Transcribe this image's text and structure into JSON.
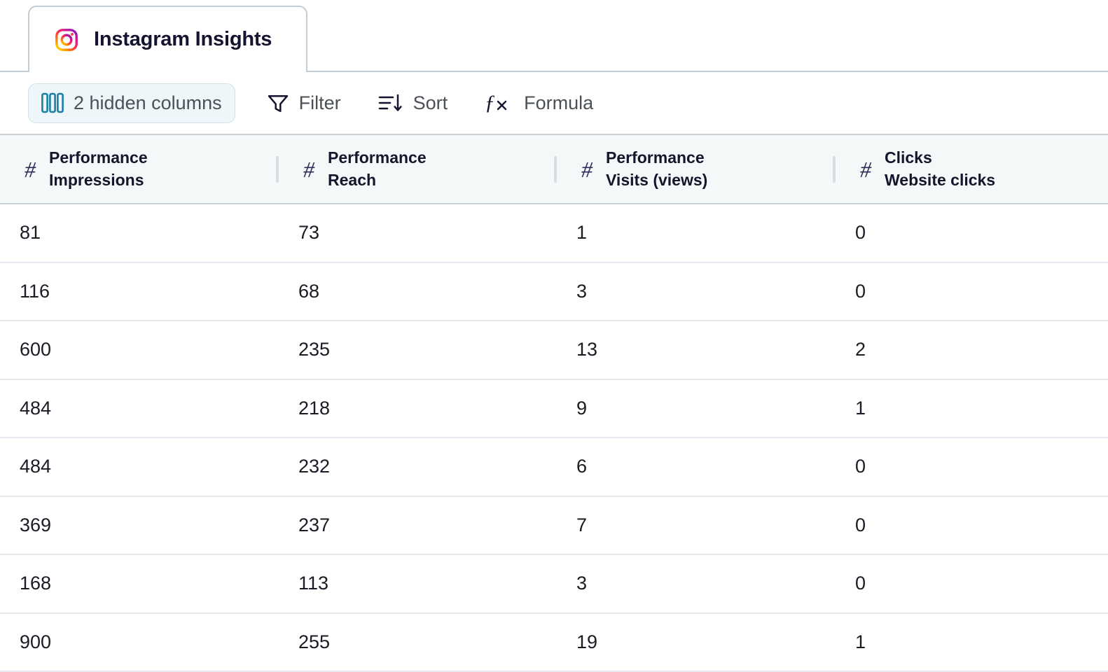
{
  "window": {
    "background": "#ffffff"
  },
  "tabs": {
    "active_index": 0,
    "items": [
      {
        "label": "Instagram Insights",
        "icon": "instagram-icon"
      }
    ]
  },
  "toolbar": {
    "hidden_columns": {
      "label": "2 hidden columns",
      "icon": "columns-icon",
      "icon_color": "#1a7fa4",
      "background": "#eef6f9",
      "border_color": "#d3e2e8",
      "text_color": "#4b5156"
    },
    "buttons": [
      {
        "label": "Filter",
        "icon": "funnel-icon"
      },
      {
        "label": "Sort",
        "icon": "sort-descending-icon"
      },
      {
        "label": "Formula",
        "icon": "function-fx-icon"
      }
    ]
  },
  "table": {
    "header_background": "#f4f8f9",
    "border_color": "#c9d2d8",
    "row_border_color": "#e4e8ef",
    "columns": [
      {
        "type_icon": "number-hash-icon",
        "group": "Performance",
        "name": "Impressions"
      },
      {
        "type_icon": "number-hash-icon",
        "group": "Performance",
        "name": "Reach"
      },
      {
        "type_icon": "number-hash-icon",
        "group": "Performance",
        "name": "Visits (views)"
      },
      {
        "type_icon": "number-hash-icon",
        "group": "Clicks",
        "name": "Website clicks"
      }
    ],
    "rows": [
      {
        "impressions": "81",
        "reach": "73",
        "visits": "1",
        "website_clicks": "0"
      },
      {
        "impressions": "116",
        "reach": "68",
        "visits": "3",
        "website_clicks": "0"
      },
      {
        "impressions": "600",
        "reach": "235",
        "visits": "13",
        "website_clicks": "2"
      },
      {
        "impressions": "484",
        "reach": "218",
        "visits": "9",
        "website_clicks": "1"
      },
      {
        "impressions": "484",
        "reach": "232",
        "visits": "6",
        "website_clicks": "0"
      },
      {
        "impressions": "369",
        "reach": "237",
        "visits": "7",
        "website_clicks": "0"
      },
      {
        "impressions": "168",
        "reach": "113",
        "visits": "3",
        "website_clicks": "0"
      },
      {
        "impressions": "900",
        "reach": "255",
        "visits": "19",
        "website_clicks": "1"
      }
    ]
  }
}
